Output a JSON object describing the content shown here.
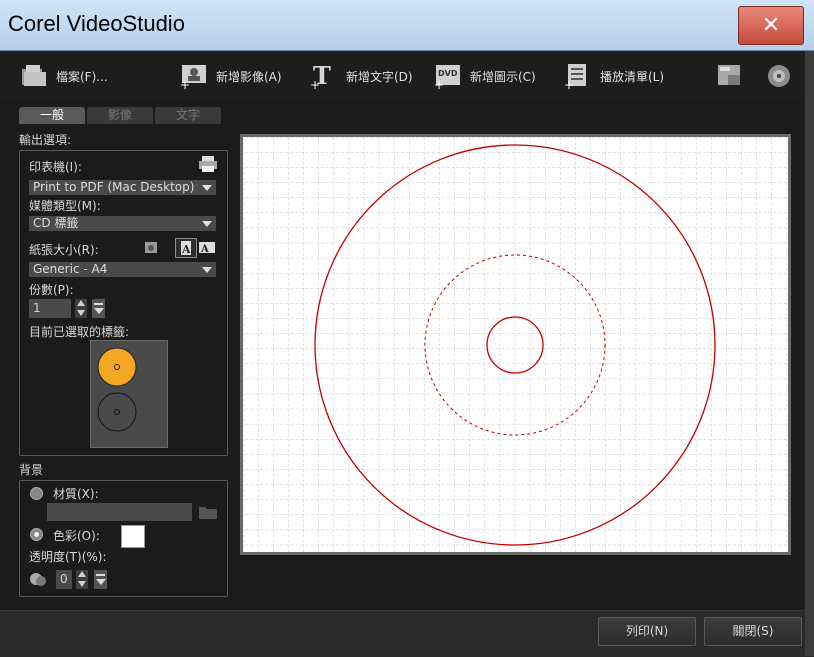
{
  "window": {
    "title": "Corel VideoStudio",
    "close_label": "✕"
  },
  "toolbar": {
    "file": "檔案(F)...",
    "add_image": "新增影像(A)",
    "add_text": "新增文字(D)",
    "add_disc_icon": "新增圖示(C)",
    "playlist": "播放清單(L)"
  },
  "tabs": [
    {
      "label": "一般",
      "active": true
    },
    {
      "label": "影像",
      "active": false
    },
    {
      "label": "文字",
      "active": false
    }
  ],
  "output": {
    "section_label": "輸出選項:",
    "printer_label": "印表機(I):",
    "printer_value": "Print to PDF (Mac Desktop)",
    "media_label": "媒體類型(M):",
    "media_value": "CD 標籤",
    "paper_label": "紙張大小(R):",
    "paper_value": "Generic - A4",
    "copies_label": "份數(P):",
    "copies_value": "1",
    "selected_label": "目前已選取的標籤:"
  },
  "background": {
    "section_label": "背景",
    "texture_label": "材質(X):",
    "color_label": "色彩(O):",
    "color_value": "#ffffff",
    "transparency_label": "透明度(T)(%):",
    "transparency_value": "0"
  },
  "footer": {
    "print": "列印(N)",
    "close": "關閉(S)"
  },
  "colors": {
    "label_ring": "#c00000",
    "selected_label": "#f5a623"
  },
  "icons": [
    "file-icon",
    "add-image-icon",
    "add-text-icon",
    "add-disc-icon",
    "playlist-icon",
    "export-icon",
    "disc-settings-icon",
    "printer-icon"
  ]
}
